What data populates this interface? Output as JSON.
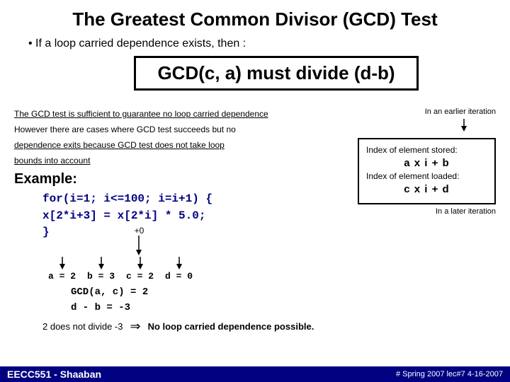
{
  "title": "The Greatest Common Divisor (GCD) Test",
  "bullet": "• If a loop carried dependence exists, then :",
  "gcd_box": "GCD(c, a)  must divide  (d-b)",
  "desc_line1": "The GCD test is sufficient to guarantee no loop carried dependence",
  "desc_line2": "However there are cases where GCD test succeeds but no",
  "desc_line3": "dependence exits because GCD test does not take loop",
  "desc_line4": "bounds into account",
  "earlier_iter_label": "In an earlier iteration",
  "right_box": {
    "index_stored_label": "Index of element stored:",
    "stored_formula": "a x i + b",
    "index_loaded_label": "Index of element loaded:",
    "loaded_formula": "c x i + d"
  },
  "later_iter_label": "In a later iteration",
  "example_label": "Example:",
  "code_line1": "for(i=1; i<=100; i=i+1) {",
  "code_line2": "    x[2*i+3] = x[2*i]  * 5.0;",
  "code_line3": "}",
  "plus_zero": "+0",
  "var_a": "a = 2",
  "var_b": "b = 3",
  "var_c": "c = 2",
  "var_d": "d = 0",
  "gcd_result1": "GCD(a, c)  =  2",
  "gcd_result2": "d - b  =  -3",
  "conclusion_left": "2  does not divide  -3",
  "arrow": "⇒",
  "conclusion_right": "No loop carried dependence possible.",
  "footer_left": "EECC551 - Shaaban",
  "footer_right": "#   Spring 2007  lec#7   4-16-2007"
}
